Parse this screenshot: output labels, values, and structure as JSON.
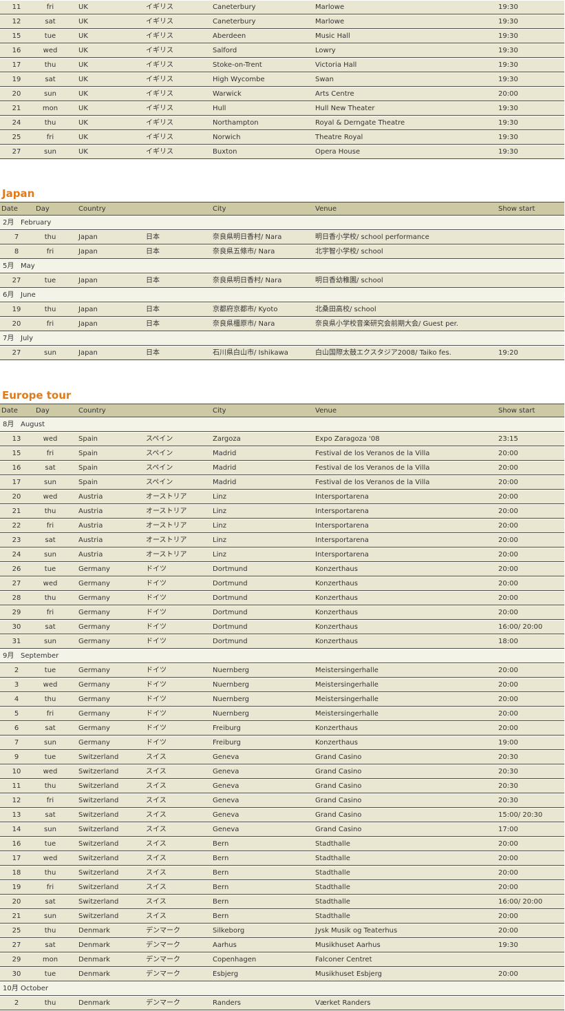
{
  "header": {
    "date": "Date",
    "day": "Day",
    "country": "Country",
    "city": "City",
    "venue": "Venue",
    "show": "Show start"
  },
  "sections": [
    {
      "title": "",
      "blocks": [
        {
          "rows": [
            {
              "date": "11",
              "day": "fri",
              "country": "UK",
              "country_jp": "イギリス",
              "city": "Caneterbury",
              "venue": "Marlowe",
              "time": "19:30"
            },
            {
              "date": "12",
              "day": "sat",
              "country": "UK",
              "country_jp": "イギリス",
              "city": "Caneterbury",
              "venue": "Marlowe",
              "time": "19:30"
            },
            {
              "date": "15",
              "day": "tue",
              "country": "UK",
              "country_jp": "イギリス",
              "city": "Aberdeen",
              "venue": "Music Hall",
              "time": "19:30"
            },
            {
              "date": "16",
              "day": "wed",
              "country": "UK",
              "country_jp": "イギリス",
              "city": "Salford",
              "venue": "Lowry",
              "time": "19:30"
            },
            {
              "date": "17",
              "day": "thu",
              "country": "UK",
              "country_jp": "イギリス",
              "city": "Stoke-on-Trent",
              "venue": "Victoria Hall",
              "time": "19:30"
            },
            {
              "date": "19",
              "day": "sat",
              "country": "UK",
              "country_jp": "イギリス",
              "city": "High Wycombe",
              "venue": "Swan",
              "time": "19:30"
            },
            {
              "date": "20",
              "day": "sun",
              "country": "UK",
              "country_jp": "イギリス",
              "city": "Warwick",
              "venue": "Arts Centre",
              "time": "20:00"
            },
            {
              "date": "21",
              "day": "mon",
              "country": "UK",
              "country_jp": "イギリス",
              "city": "Hull",
              "venue": "Hull New Theater",
              "time": "19:30"
            },
            {
              "date": "24",
              "day": "thu",
              "country": "UK",
              "country_jp": "イギリス",
              "city": "Northampton",
              "venue": "Royal & Derngate Theatre",
              "time": "19:30"
            },
            {
              "date": "25",
              "day": "fri",
              "country": "UK",
              "country_jp": "イギリス",
              "city": "Norwich",
              "venue": "Theatre Royal",
              "time": "19:30"
            },
            {
              "date": "27",
              "day": "sun",
              "country": "UK",
              "country_jp": "イギリス",
              "city": "Buxton",
              "venue": "Opera House",
              "time": "19:30"
            }
          ]
        }
      ]
    },
    {
      "title": "Japan",
      "blocks": [
        {
          "month_jp": "2月",
          "month_en": "February",
          "rows": [
            {
              "date": "7",
              "day": "thu",
              "country": "Japan",
              "country_jp": "日本",
              "city": "奈良県明日香村/ Nara",
              "venue": "明日香小学校/ school performance",
              "time": ""
            },
            {
              "date": "8",
              "day": "fri",
              "country": "Japan",
              "country_jp": "日本",
              "city": "奈良県五條市/ Nara",
              "venue": "北宇智小学校/ school",
              "time": ""
            }
          ]
        },
        {
          "month_jp": "5月",
          "month_en": "May",
          "rows": [
            {
              "date": "27",
              "day": "tue",
              "country": "Japan",
              "country_jp": "日本",
              "city": "奈良県明日香村/ Nara",
              "venue": "明日香幼稚園/ school",
              "time": ""
            }
          ]
        },
        {
          "month_jp": "6月",
          "month_en": "June",
          "rows": [
            {
              "date": "19",
              "day": "thu",
              "country": "Japan",
              "country_jp": "日本",
              "city": "京都府京都市/ Kyoto",
              "venue": "北桑田高校/ school",
              "time": ""
            },
            {
              "date": "20",
              "day": "fri",
              "country": "Japan",
              "country_jp": "日本",
              "city": "奈良県橿原市/ Nara",
              "venue": "奈良県小学校音楽研究会前期大会/ Guest per.",
              "time": ""
            }
          ]
        },
        {
          "month_jp": "7月",
          "month_en": "July",
          "rows": [
            {
              "date": "27",
              "day": "sun",
              "country": "Japan",
              "country_jp": "日本",
              "city": "石川県白山市/ Ishikawa",
              "venue": "白山国際太鼓エクスタジア2008/ Taiko fes.",
              "time": "19:20"
            }
          ]
        }
      ]
    },
    {
      "title": "Europe tour",
      "blocks": [
        {
          "month_jp": "8月",
          "month_en": "August",
          "rows": [
            {
              "date": "13",
              "day": "wed",
              "country": "Spain",
              "country_jp": "スペイン",
              "city": "Zargoza",
              "venue": "Expo Zaragoza '08",
              "time": "23:15"
            },
            {
              "date": "15",
              "day": "fri",
              "country": "Spain",
              "country_jp": "スペイン",
              "city": "Madrid",
              "venue": "Festival de los Veranos de la Villa",
              "time": "20:00"
            },
            {
              "date": "16",
              "day": "sat",
              "country": "Spain",
              "country_jp": "スペイン",
              "city": "Madrid",
              "venue": "Festival de los Veranos de la Villa",
              "time": "20:00"
            },
            {
              "date": "17",
              "day": "sun",
              "country": "Spain",
              "country_jp": "スペイン",
              "city": "Madrid",
              "venue": "Festival de los Veranos de la Villa",
              "time": "20:00"
            },
            {
              "date": "20",
              "day": "wed",
              "country": "Austria",
              "country_jp": "オーストリア",
              "city": "Linz",
              "venue": "Intersportarena",
              "time": "20:00"
            },
            {
              "date": "21",
              "day": "thu",
              "country": "Austria",
              "country_jp": "オーストリア",
              "city": "Linz",
              "venue": "Intersportarena",
              "time": "20:00"
            },
            {
              "date": "22",
              "day": "fri",
              "country": "Austria",
              "country_jp": "オーストリア",
              "city": "Linz",
              "venue": "Intersportarena",
              "time": "20:00"
            },
            {
              "date": "23",
              "day": "sat",
              "country": "Austria",
              "country_jp": "オーストリア",
              "city": "Linz",
              "venue": "Intersportarena",
              "time": "20:00"
            },
            {
              "date": "24",
              "day": "sun",
              "country": "Austria",
              "country_jp": "オーストリア",
              "city": "Linz",
              "venue": "Intersportarena",
              "time": "20:00"
            },
            {
              "date": "26",
              "day": "tue",
              "country": "Germany",
              "country_jp": "ドイツ",
              "city": "Dortmund",
              "venue": "Konzerthaus",
              "time": "20:00"
            },
            {
              "date": "27",
              "day": "wed",
              "country": "Germany",
              "country_jp": "ドイツ",
              "city": "Dortmund",
              "venue": "Konzerthaus",
              "time": "20:00"
            },
            {
              "date": "28",
              "day": "thu",
              "country": "Germany",
              "country_jp": "ドイツ",
              "city": "Dortmund",
              "venue": "Konzerthaus",
              "time": "20:00"
            },
            {
              "date": "29",
              "day": "fri",
              "country": "Germany",
              "country_jp": "ドイツ",
              "city": "Dortmund",
              "venue": "Konzerthaus",
              "time": "20:00"
            },
            {
              "date": "30",
              "day": "sat",
              "country": "Germany",
              "country_jp": "ドイツ",
              "city": "Dortmund",
              "venue": "Konzerthaus",
              "time": "16:00/ 20:00"
            },
            {
              "date": "31",
              "day": "sun",
              "country": "Germany",
              "country_jp": "ドイツ",
              "city": "Dortmund",
              "venue": "Konzerthaus",
              "time": "18:00"
            }
          ]
        },
        {
          "month_jp": "9月",
          "month_en": "September",
          "rows": [
            {
              "date": "2",
              "day": "tue",
              "country": "Germany",
              "country_jp": "ドイツ",
              "city": "Nuernberg",
              "venue": "Meistersingerhalle",
              "time": "20:00"
            },
            {
              "date": "3",
              "day": "wed",
              "country": "Germany",
              "country_jp": "ドイツ",
              "city": "Nuernberg",
              "venue": "Meistersingerhalle",
              "time": "20:00"
            },
            {
              "date": "4",
              "day": "thu",
              "country": "Germany",
              "country_jp": "ドイツ",
              "city": "Nuernberg",
              "venue": "Meistersingerhalle",
              "time": "20:00"
            },
            {
              "date": "5",
              "day": "fri",
              "country": "Germany",
              "country_jp": "ドイツ",
              "city": "Nuernberg",
              "venue": "Meistersingerhalle",
              "time": "20:00"
            },
            {
              "date": "6",
              "day": "sat",
              "country": "Germany",
              "country_jp": "ドイツ",
              "city": "Freiburg",
              "venue": "Konzerthaus",
              "time": "20:00"
            },
            {
              "date": "7",
              "day": "sun",
              "country": "Germany",
              "country_jp": "ドイツ",
              "city": "Freiburg",
              "venue": "Konzerthaus",
              "time": "19:00"
            },
            {
              "date": "9",
              "day": "tue",
              "country": "Switzerland",
              "country_jp": "スイス",
              "city": "Geneva",
              "venue": "Grand Casino",
              "time": "20:30"
            },
            {
              "date": "10",
              "day": "wed",
              "country": "Switzerland",
              "country_jp": "スイス",
              "city": "Geneva",
              "venue": "Grand Casino",
              "time": "20:30"
            },
            {
              "date": "11",
              "day": "thu",
              "country": "Switzerland",
              "country_jp": "スイス",
              "city": "Geneva",
              "venue": "Grand Casino",
              "time": "20:30"
            },
            {
              "date": "12",
              "day": "fri",
              "country": "Switzerland",
              "country_jp": "スイス",
              "city": "Geneva",
              "venue": "Grand Casino",
              "time": "20:30"
            },
            {
              "date": "13",
              "day": "sat",
              "country": "Switzerland",
              "country_jp": "スイス",
              "city": "Geneva",
              "venue": "Grand Casino",
              "time": "15:00/ 20:30"
            },
            {
              "date": "14",
              "day": "sun",
              "country": "Switzerland",
              "country_jp": "スイス",
              "city": "Geneva",
              "venue": "Grand Casino",
              "time": "17:00"
            },
            {
              "date": "16",
              "day": "tue",
              "country": "Switzerland",
              "country_jp": "スイス",
              "city": "Bern",
              "venue": "Stadthalle",
              "time": "20:00"
            },
            {
              "date": "17",
              "day": "wed",
              "country": "Switzerland",
              "country_jp": "スイス",
              "city": "Bern",
              "venue": "Stadthalle",
              "time": "20:00"
            },
            {
              "date": "18",
              "day": "thu",
              "country": "Switzerland",
              "country_jp": "スイス",
              "city": "Bern",
              "venue": "Stadthalle",
              "time": "20:00"
            },
            {
              "date": "19",
              "day": "fri",
              "country": "Switzerland",
              "country_jp": "スイス",
              "city": "Bern",
              "venue": "Stadthalle",
              "time": "20:00"
            },
            {
              "date": "20",
              "day": "sat",
              "country": "Switzerland",
              "country_jp": "スイス",
              "city": "Bern",
              "venue": "Stadthalle",
              "time": "16:00/ 20:00"
            },
            {
              "date": "21",
              "day": "sun",
              "country": "Switzerland",
              "country_jp": "スイス",
              "city": "Bern",
              "venue": "Stadthalle",
              "time": "20:00"
            },
            {
              "date": "25",
              "day": "thu",
              "country": "Denmark",
              "country_jp": "デンマーク",
              "city": "Silkeborg",
              "venue": "Jysk Musik og Teaterhus",
              "time": "20:00"
            },
            {
              "date": "27",
              "day": "sat",
              "country": "Denmark",
              "country_jp": "デンマーク",
              "city": "Aarhus",
              "venue": "Musikhuset Aarhus",
              "time": "19:30"
            },
            {
              "date": "29",
              "day": "mon",
              "country": "Denmark",
              "country_jp": "デンマーク",
              "city": "Copenhagen",
              "venue": "Falconer Centret",
              "time": ""
            },
            {
              "date": "30",
              "day": "tue",
              "country": "Denmark",
              "country_jp": "デンマーク",
              "city": "Esbjerg",
              "venue": "Musikhuset Esbjerg",
              "time": "20:00"
            }
          ]
        },
        {
          "month_jp": "10月",
          "month_en": "October",
          "rows": [
            {
              "date": "2",
              "day": "thu",
              "country": "Denmark",
              "country_jp": "デンマーク",
              "city": "Randers",
              "venue": "Værket Randers",
              "time": ""
            }
          ]
        }
      ]
    }
  ]
}
